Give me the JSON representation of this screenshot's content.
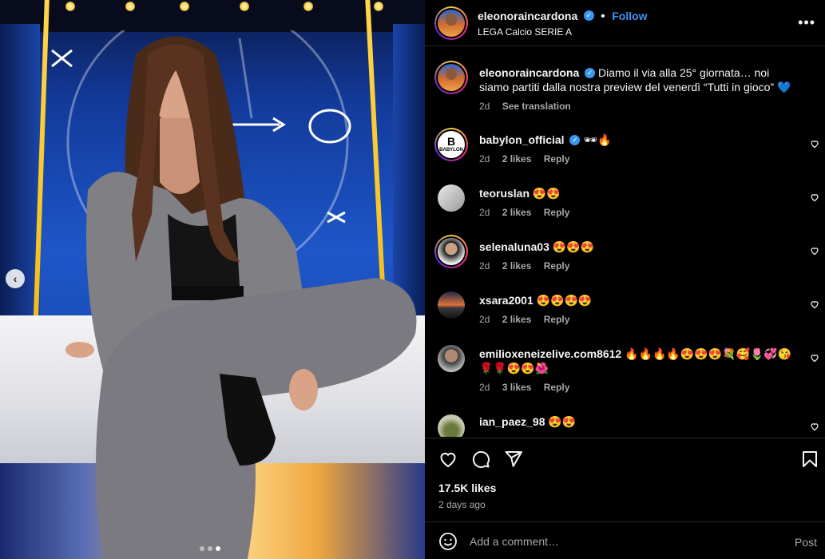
{
  "post": {
    "username": "eleonoraincardona",
    "follow_label": "Follow",
    "location": "LEGA Calcio SERIE A",
    "more_label": "•••",
    "caption_text": "Diamo il via alla 25° giornata… noi siamo partiti dalla nostra preview del venerdì “Tutti in gioco” 💙",
    "caption_time": "2d",
    "see_translation": "See translation",
    "likes": "17.5K likes",
    "posted": "2 days ago",
    "carousel_prev": "‹"
  },
  "comments": [
    {
      "user": "babylon_official",
      "verified": true,
      "text": "🕶🔥",
      "time": "2d",
      "likes": "2 likes",
      "reply": "Reply",
      "avatar_text": "BABYLON"
    },
    {
      "user": "teoruslan",
      "verified": false,
      "text": "😍😍",
      "time": "2d",
      "likes": "2 likes",
      "reply": "Reply"
    },
    {
      "user": "selenaluna03",
      "verified": false,
      "text": "😍😍😍",
      "time": "2d",
      "likes": "2 likes",
      "reply": "Reply"
    },
    {
      "user": "xsara2001",
      "verified": false,
      "text": "😍😍😍😍",
      "time": "2d",
      "likes": "2 likes",
      "reply": "Reply"
    },
    {
      "user": "emilioxeneizelive.com8612",
      "verified": false,
      "text": "🔥🔥🔥🔥😍😍😍💐🥰🌷💞😘🌹🌹😍😍🌺",
      "time": "2d",
      "likes": "3 likes",
      "reply": "Reply"
    },
    {
      "user": "ian_paez_98",
      "verified": false,
      "text": "😍😍"
    }
  ],
  "composer": {
    "placeholder": "Add a comment…",
    "post_label": "Post"
  },
  "colors": {
    "accent": "#4193f5",
    "verified": "#3897f0",
    "muted": "#a8a8a8",
    "background": "#000000"
  }
}
